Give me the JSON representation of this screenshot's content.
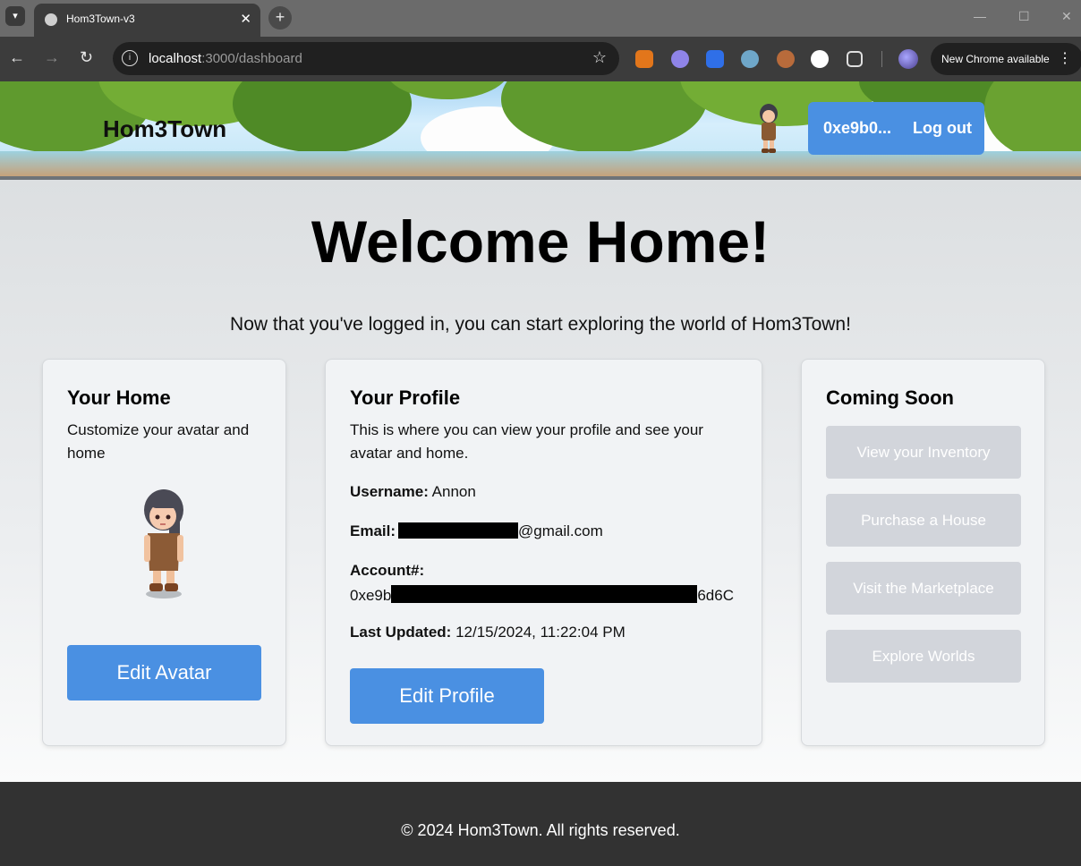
{
  "browser": {
    "tab_title": "Hom3Town-v3",
    "url_host": "localhost",
    "url_path": ":3000/dashboard",
    "update_label": "New Chrome available"
  },
  "header": {
    "brand": "Hom3Town",
    "wallet_short": "0xe9b0...",
    "logout_label": "Log out"
  },
  "hero": {
    "title": "Welcome Home!",
    "subtitle": "Now that you've logged in, you can start exploring the world of Hom3Town!"
  },
  "home_card": {
    "title": "Your Home",
    "description": "Customize your avatar and home",
    "button": "Edit Avatar"
  },
  "profile_card": {
    "title": "Your Profile",
    "description": "This is where you can view your profile and see your avatar and home.",
    "username_label": "Username:",
    "username": "Annon",
    "email_label": "Email:",
    "email_suffix": "@gmail.com",
    "account_label": "Account#:",
    "account_prefix": "0xe9b",
    "account_suffix": "6d6C",
    "updated_label": "Last Updated:",
    "updated_value": "12/15/2024, 11:22:04 PM",
    "button": "Edit Profile"
  },
  "soon_card": {
    "title": "Coming Soon",
    "items": [
      "View your Inventory",
      "Purchase a House",
      "Visit the Marketplace",
      "Explore Worlds"
    ]
  },
  "footer": {
    "text": "© 2024 Hom3Town. All rights reserved."
  },
  "colors": {
    "accent": "#4a90e2",
    "disabled": "#d2d5db",
    "footer": "#323232"
  }
}
